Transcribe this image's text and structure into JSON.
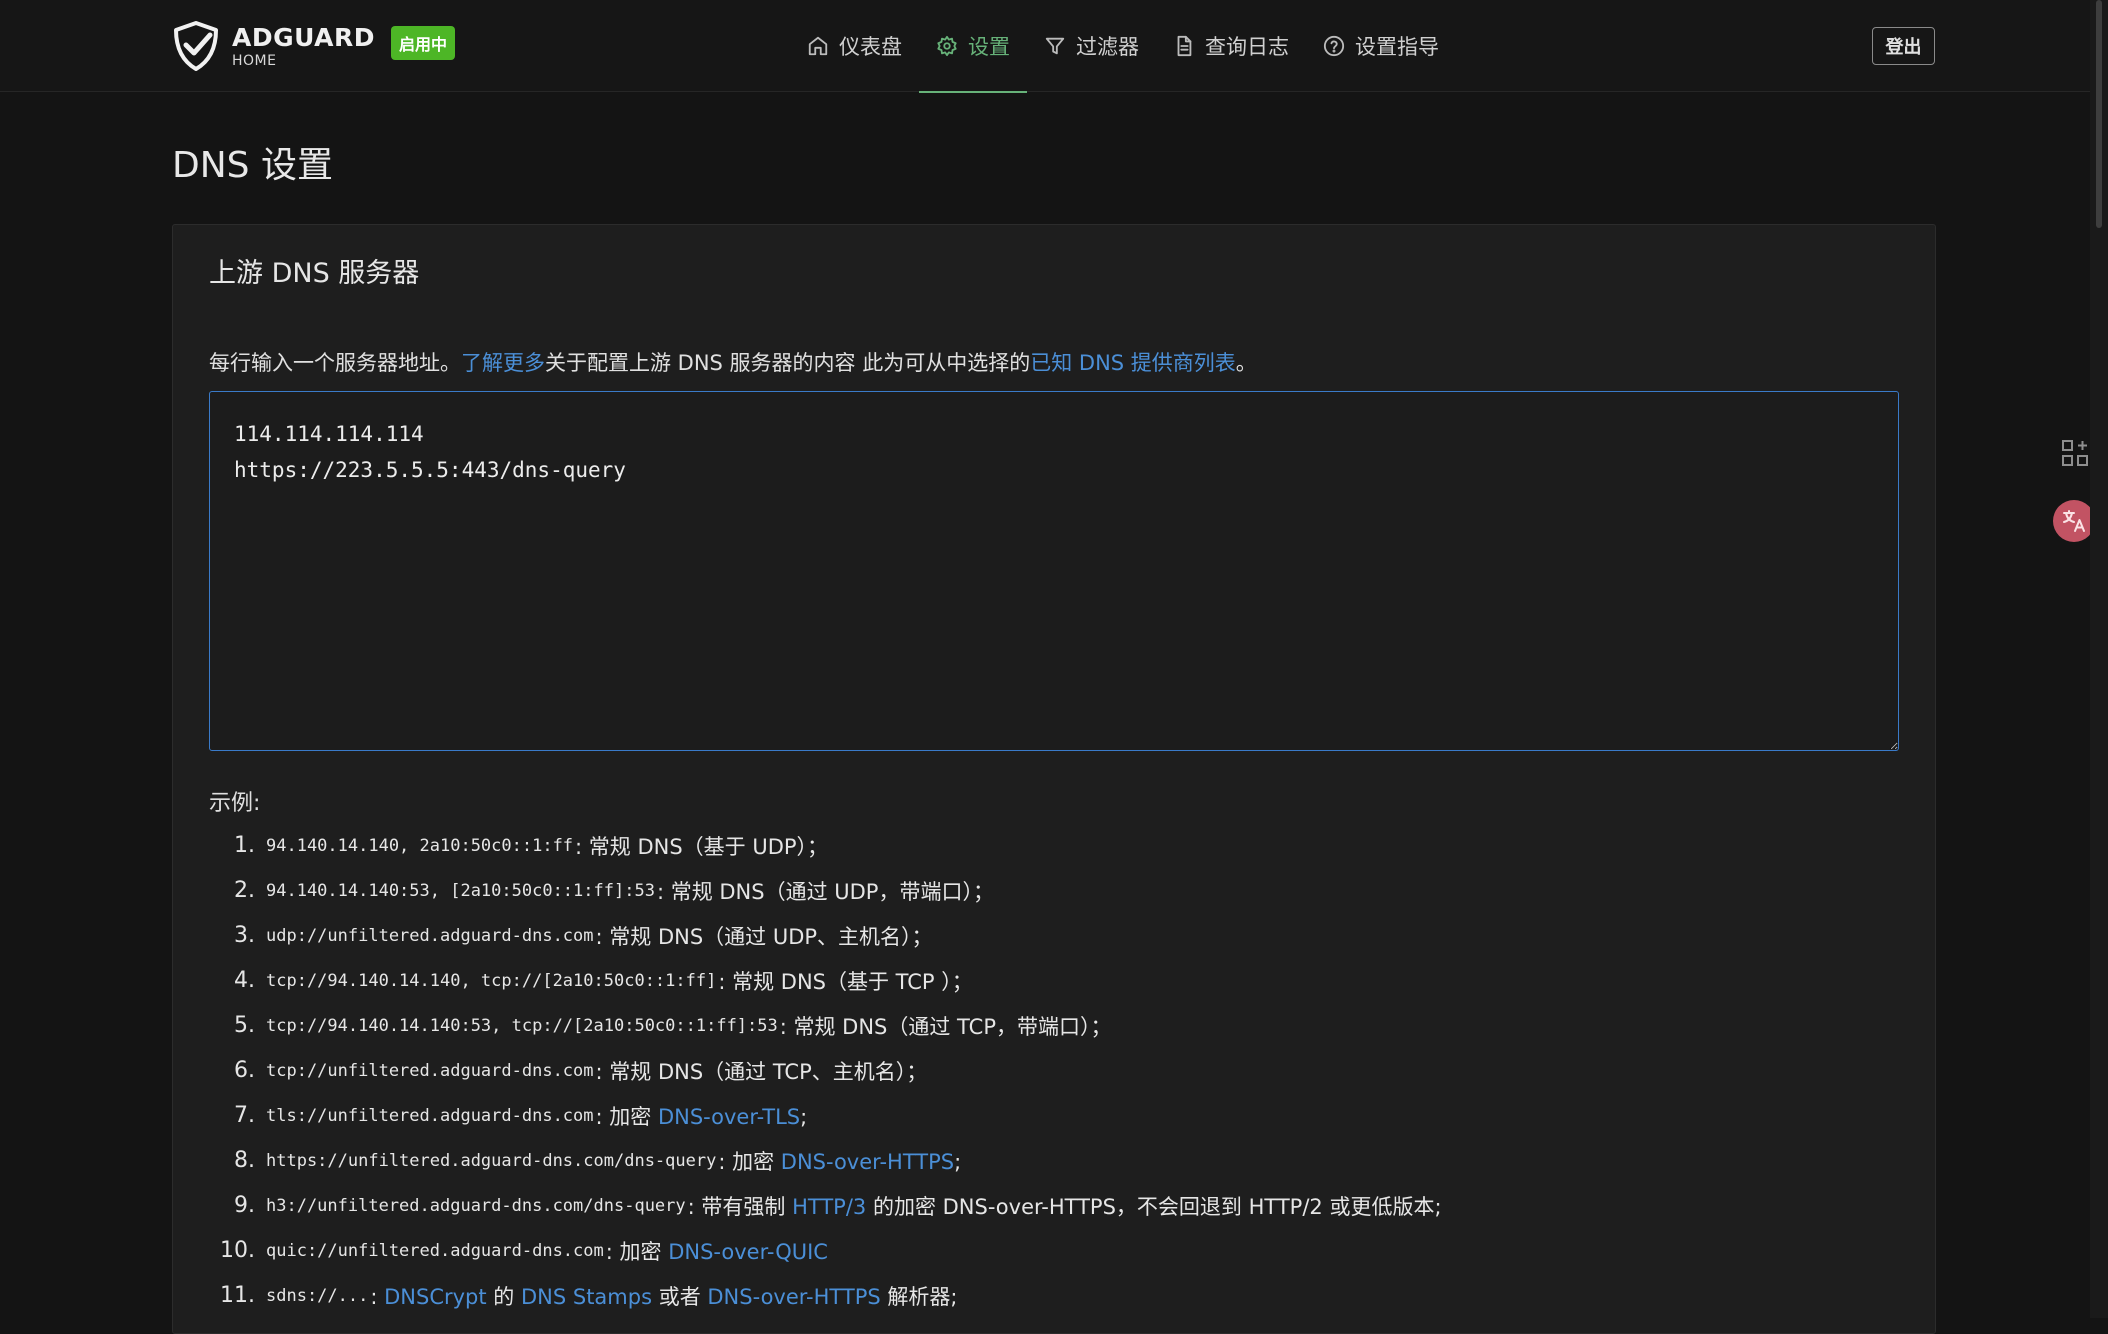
{
  "header": {
    "brand_name": "ADGUARD",
    "brand_sub": "HOME",
    "status_badge": "启用中",
    "nav": [
      {
        "label": "仪表盘",
        "icon": "home-icon"
      },
      {
        "label": "设置",
        "icon": "gear-icon",
        "active": true
      },
      {
        "label": "过滤器",
        "icon": "filter-icon"
      },
      {
        "label": "查询日志",
        "icon": "document-icon"
      },
      {
        "label": "设置指导",
        "icon": "help-circle-icon"
      }
    ],
    "logout_label": "登出"
  },
  "page": {
    "title": "DNS 设置"
  },
  "upstream": {
    "title": "上游 DNS 服务器",
    "help_prefix": "每行输入一个服务器地址。",
    "help_link1": "了解更多",
    "help_middle": "关于配置上游 DNS 服务器的内容 此为可从中选择的",
    "help_link2": "已知 DNS 提供商列表",
    "help_suffix": "。",
    "servers_value": "114.114.114.114\nhttps://223.5.5.5:443/dns-query",
    "examples_label": "示例:",
    "examples": [
      {
        "num": "1.",
        "code": "94.140.14.140, 2a10:50c0::1:ff",
        "desc": [
          {
            "t": ": 常规 DNS（基于 UDP）；"
          }
        ]
      },
      {
        "num": "2.",
        "code": "94.140.14.140:53, [2a10:50c0::1:ff]:53",
        "desc": [
          {
            "t": ": 常规 DNS（通过 UDP，带端口）；"
          }
        ]
      },
      {
        "num": "3.",
        "code": "udp://unfiltered.adguard-dns.com",
        "desc": [
          {
            "t": ": 常规 DNS（通过 UDP、主机名）；"
          }
        ]
      },
      {
        "num": "4.",
        "code": "tcp://94.140.14.140, tcp://[2a10:50c0::1:ff]",
        "desc": [
          {
            "t": ": 常规 DNS（基于 TCP ）；"
          }
        ]
      },
      {
        "num": "5.",
        "code": "tcp://94.140.14.140:53, tcp://[2a10:50c0::1:ff]:53",
        "desc": [
          {
            "t": ": 常规 DNS（通过 TCP，带端口）；"
          }
        ]
      },
      {
        "num": "6.",
        "code": "tcp://unfiltered.adguard-dns.com",
        "desc": [
          {
            "t": ": 常规 DNS（通过 TCP、主机名）；"
          }
        ]
      },
      {
        "num": "7.",
        "code": "tls://unfiltered.adguard-dns.com",
        "desc": [
          {
            "t": ": 加密 "
          },
          {
            "t": "DNS-over-TLS",
            "link": true
          },
          {
            "t": ";"
          }
        ]
      },
      {
        "num": "8.",
        "code": "https://unfiltered.adguard-dns.com/dns-query",
        "desc": [
          {
            "t": ": 加密 "
          },
          {
            "t": "DNS-over-HTTPS",
            "link": true
          },
          {
            "t": ";"
          }
        ]
      },
      {
        "num": "9.",
        "code": "h3://unfiltered.adguard-dns.com/dns-query",
        "desc": [
          {
            "t": ": 带有强制 "
          },
          {
            "t": "HTTP/3",
            "link": true
          },
          {
            "t": " 的加密 DNS-over-HTTPS，不会回退到 HTTP/2 或更低版本;"
          }
        ]
      },
      {
        "num": "10.",
        "code": "quic://unfiltered.adguard-dns.com",
        "desc": [
          {
            "t": ": 加密 "
          },
          {
            "t": "DNS-over-QUIC",
            "link": true
          }
        ]
      },
      {
        "num": "11.",
        "code": "sdns://...",
        "desc": [
          {
            "t": ": "
          },
          {
            "t": "DNSCrypt",
            "link": true
          },
          {
            "t": " 的 "
          },
          {
            "t": "DNS Stamps",
            "link": true
          },
          {
            "t": " 或者 "
          },
          {
            "t": "DNS-over-HTTPS",
            "link": true
          },
          {
            "t": " 解析器;"
          }
        ]
      }
    ]
  },
  "colors": {
    "accent_green": "#67b279",
    "badge_green": "#4db626",
    "link_blue": "#4b8fd7",
    "background": "#141414",
    "card": "#1e1e1e"
  }
}
